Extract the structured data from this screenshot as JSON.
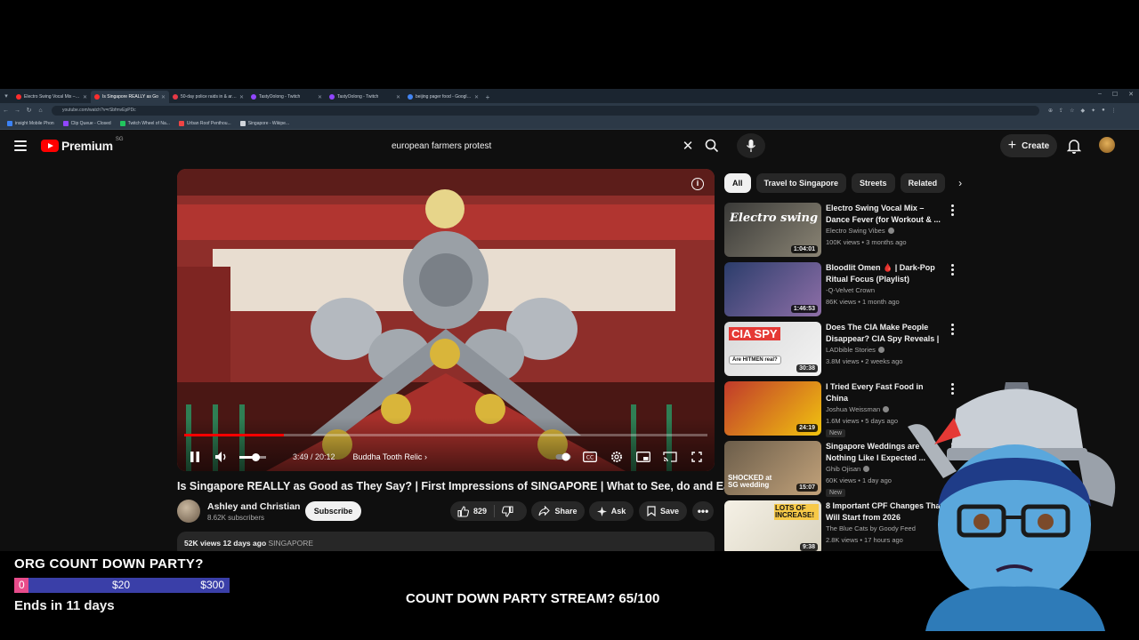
{
  "browser": {
    "tabs": [
      {
        "label": "Electro Swing Vocal Mix – Elect",
        "color": "#ff2d2d",
        "active": false
      },
      {
        "label": "Is Singapore REALLY as Go",
        "color": "#ff2d2d",
        "active": true
      },
      {
        "label": "50-day police raids in & aroun",
        "color": "#e63946",
        "active": false
      },
      {
        "label": "TastyOolong - Twitch",
        "color": "#9146ff",
        "active": false
      },
      {
        "label": "TastyOolong - Twitch",
        "color": "#9146ff",
        "active": false
      },
      {
        "label": "beijing pager food - Google S",
        "color": "#4285f4",
        "active": false
      }
    ],
    "url": "youtube.com/watch?v=rSbfmvEpPDc",
    "bookmarks": [
      {
        "label": "insight Mobile Phon",
        "color": "#3b82f6"
      },
      {
        "label": "Clip Queue - Closed",
        "color": "#9146ff"
      },
      {
        "label": "Twitch Wheel of Na...",
        "color": "#22c55e"
      },
      {
        "label": "Urban Roof Penthou...",
        "color": "#ef4444"
      },
      {
        "label": "Singapore - Wikipe...",
        "color": "#d1d5db"
      }
    ]
  },
  "header": {
    "logo_text": "Premium",
    "region": "SG",
    "search_value": "european farmers protest",
    "create_label": "Create"
  },
  "player": {
    "time": "3:49 / 20:12",
    "chapter": "Buddha Tooth Relic",
    "progress_fraction": 0.19
  },
  "video": {
    "title": "Is Singapore REALLY as Good as They Say? | First Impressions of SINGAPORE | What to See, do and Eat",
    "channel": "Ashley and Christian",
    "subscribers": "8.62K subscribers",
    "subscribe_label": "Subscribe",
    "likes": "829",
    "share_label": "Share",
    "ask_label": "Ask",
    "save_label": "Save",
    "views_date": "52K views  12 days ago",
    "tag": "SINGAPORE"
  },
  "chips": [
    "All",
    "Travel to Singapore",
    "Streets",
    "Related"
  ],
  "recommendations": [
    {
      "title": "Electro Swing Vocal Mix – Dance Fever (for Workout & ...",
      "channel": "Electro Swing Vibes",
      "meta": "100K views • 3 months ago",
      "duration": "1:04:01",
      "verified": true,
      "new": false
    },
    {
      "title": "Bloodlit Omen 🩸 | Dark-Pop Ritual Focus (Playlist)",
      "channel": "-Q-Velvet Crown",
      "meta": "86K views • 1 month ago",
      "duration": "1:46:53",
      "verified": false,
      "new": false
    },
    {
      "title": "Does The CIA Make People Disappear? CIA Spy Reveals | ...",
      "channel": "LADbible Stories",
      "meta": "3.8M views • 2 weeks ago",
      "duration": "30:38",
      "verified": true,
      "new": false
    },
    {
      "title": "I Tried Every Fast Food in China",
      "channel": "Joshua Weissman",
      "meta": "1.6M views • 5 days ago",
      "duration": "24:19",
      "verified": true,
      "new": true
    },
    {
      "title": "Singapore Weddings are Nothing Like I Expected ...",
      "channel": "Ghib Ojisan",
      "meta": "60K views • 1 day ago",
      "duration": "15:07",
      "verified": true,
      "new": true
    },
    {
      "title": "8 Important CPF Changes That Will Start from 2026",
      "channel": "The Blue Cats by Goody Feed",
      "meta": "2.8K views • 17 hours ago",
      "duration": "9:38",
      "verified": false,
      "new": false
    }
  ],
  "thumb_words": {
    "electro": "Electro swing",
    "cia": "CIA SPY",
    "cia_sub": "Are HITMEN real?",
    "wedding": "SHOCKED at SG wedding",
    "cpf": "LOTS OF INCREASE!"
  },
  "overlay": {
    "goal_title": "ORG COUNT DOWN PARTY?",
    "bar_start": "0",
    "bar_mid": "$20",
    "bar_end": "$300",
    "bar_fraction": 0.0,
    "ends": "Ends in 11 days",
    "countdown": "COUNT DOWN PARTY STREAM? 65/100"
  }
}
